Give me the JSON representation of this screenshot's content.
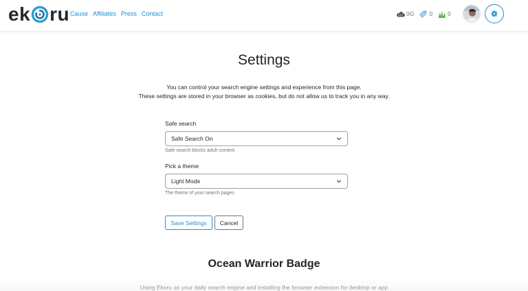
{
  "brand": {
    "logo_left": "ek",
    "logo_right": "ru",
    "logo_icon": "swirl-o-icon"
  },
  "nav": {
    "links": [
      "Cause",
      "Affiliates",
      "Press",
      "Contact"
    ]
  },
  "stats": [
    {
      "icon": "cloud-icon",
      "value": "0G"
    },
    {
      "icon": "bottle-icon",
      "value": "0"
    },
    {
      "icon": "grass-icon",
      "value": "0"
    }
  ],
  "colors": {
    "accent": "#1a8fd6",
    "text": "#212529",
    "muted": "#6c757d"
  },
  "settings": {
    "title": "Settings",
    "description_line1": "You can control your search engine settings and experience from this page.",
    "description_line2": "These settings are stored in your browser as cookies, but do not allow us to track you in any way.",
    "safe_search": {
      "label": "Safe search",
      "value": "Safe Search On",
      "help": "Safe search blocks adult content"
    },
    "theme": {
      "label": "Pick a theme",
      "value": "Light Mode",
      "help": "The theme of your search pages"
    },
    "save_label": "Save Settings",
    "cancel_label": "Cancel"
  },
  "badge_section": {
    "title": "Ocean Warrior Badge",
    "text": "Using Ekoru as your daily search engine and installing the browser extension for desktop or app"
  }
}
